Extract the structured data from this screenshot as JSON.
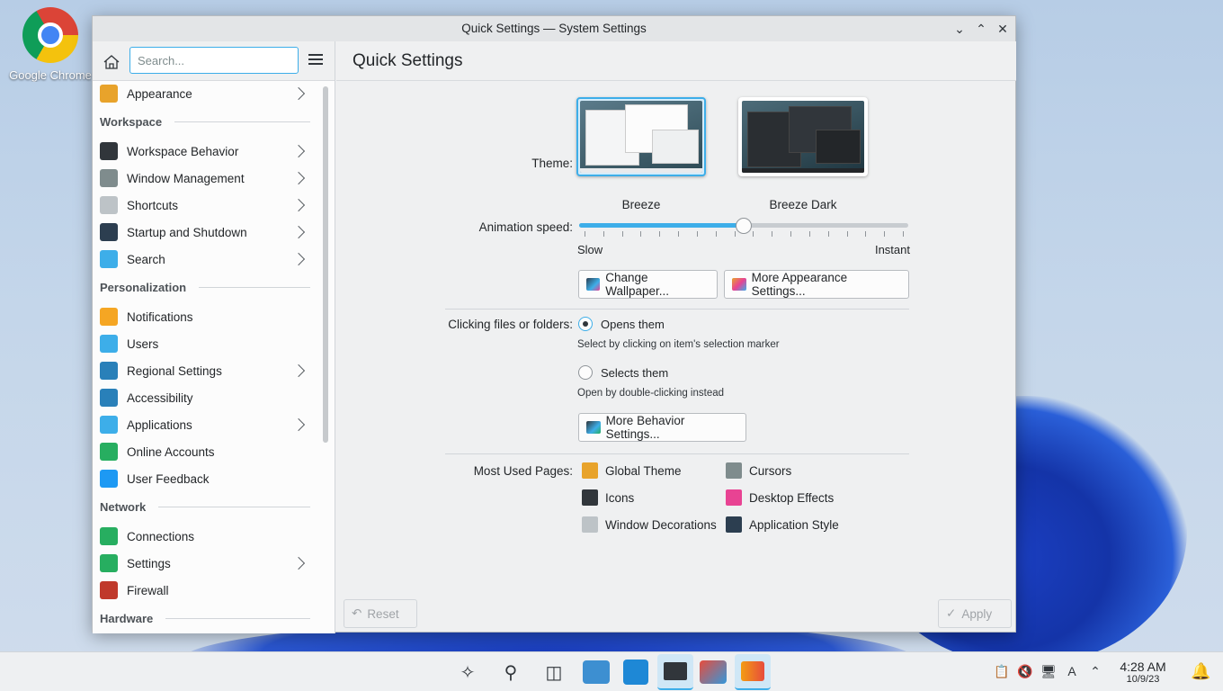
{
  "desktop": {
    "icons": [
      {
        "label": "Google Chrome",
        "icon": "chrome-icon"
      }
    ]
  },
  "window": {
    "title": "Quick Settings — System Settings",
    "controls": [
      "minimize",
      "maximize",
      "close"
    ]
  },
  "sidebar": {
    "search_placeholder": "Search...",
    "items": [
      {
        "label": "Appearance",
        "icon": "appearance-icon",
        "color": "#e8a32b",
        "has_children": true
      },
      {
        "section": "Workspace"
      },
      {
        "label": "Workspace Behavior",
        "icon": "workspace-behavior-icon",
        "color": "#31363b",
        "has_children": true
      },
      {
        "label": "Window Management",
        "icon": "window-management-icon",
        "color": "#7f8c8d",
        "has_children": true
      },
      {
        "label": "Shortcuts",
        "icon": "keyboard-icon",
        "color": "#bdc3c7",
        "has_children": true
      },
      {
        "label": "Startup and Shutdown",
        "icon": "startup-icon",
        "color": "#2c3e50",
        "has_children": true
      },
      {
        "label": "Search",
        "icon": "search-icon",
        "color": "#3daee9",
        "has_children": true
      },
      {
        "section": "Personalization"
      },
      {
        "label": "Notifications",
        "icon": "bell-icon",
        "color": "#f5a623",
        "has_children": false
      },
      {
        "label": "Users",
        "icon": "users-icon",
        "color": "#3daee9",
        "has_children": false
      },
      {
        "label": "Regional Settings",
        "icon": "regional-icon",
        "color": "#2980b9",
        "has_children": true
      },
      {
        "label": "Accessibility",
        "icon": "accessibility-icon",
        "color": "#2980b9",
        "has_children": false
      },
      {
        "label": "Applications",
        "icon": "applications-icon",
        "color": "#3daee9",
        "has_children": true
      },
      {
        "label": "Online Accounts",
        "icon": "online-accounts-icon",
        "color": "#27ae60",
        "has_children": false
      },
      {
        "label": "User Feedback",
        "icon": "feedback-icon",
        "color": "#1d99f3",
        "has_children": false
      },
      {
        "section": "Network"
      },
      {
        "label": "Connections",
        "icon": "globe-icon",
        "color": "#27ae60",
        "has_children": false
      },
      {
        "label": "Settings",
        "icon": "network-settings-icon",
        "color": "#27ae60",
        "has_children": true
      },
      {
        "label": "Firewall",
        "icon": "firewall-icon",
        "color": "#c0392b",
        "has_children": false
      },
      {
        "section": "Hardware"
      }
    ]
  },
  "main": {
    "title": "Quick Settings",
    "theme_label": "Theme:",
    "themes": [
      {
        "name": "Breeze",
        "selected": true
      },
      {
        "name": "Breeze Dark",
        "selected": false
      }
    ],
    "animation_label": "Animation speed:",
    "animation_min": "Slow",
    "animation_max": "Instant",
    "animation_value": 0.5,
    "change_wallpaper": "Change Wallpaper...",
    "more_appearance": "More Appearance Settings...",
    "clicking_label": "Clicking files or folders:",
    "opens_them": "Opens them",
    "opens_hint": "Select by clicking on item's selection marker",
    "selects_them": "Selects them",
    "selects_hint": "Open by double-clicking instead",
    "more_behavior": "More Behavior Settings...",
    "most_used_label": "Most Used Pages:",
    "most_used": [
      {
        "label": "Global Theme",
        "color": "#e8a32b"
      },
      {
        "label": "Cursors",
        "color": "#7f8c8d"
      },
      {
        "label": "Icons",
        "color": "#31363b"
      },
      {
        "label": "Desktop Effects",
        "color": "#e84393"
      },
      {
        "label": "Window Decorations",
        "color": "#bdc3c7"
      },
      {
        "label": "Application Style",
        "color": "#2c3e50"
      }
    ],
    "reset": "Reset",
    "apply": "Apply"
  },
  "taskbar": {
    "time": "4:28 AM",
    "date": "10/9/23"
  },
  "colors": {
    "accent": "#3daee9"
  }
}
